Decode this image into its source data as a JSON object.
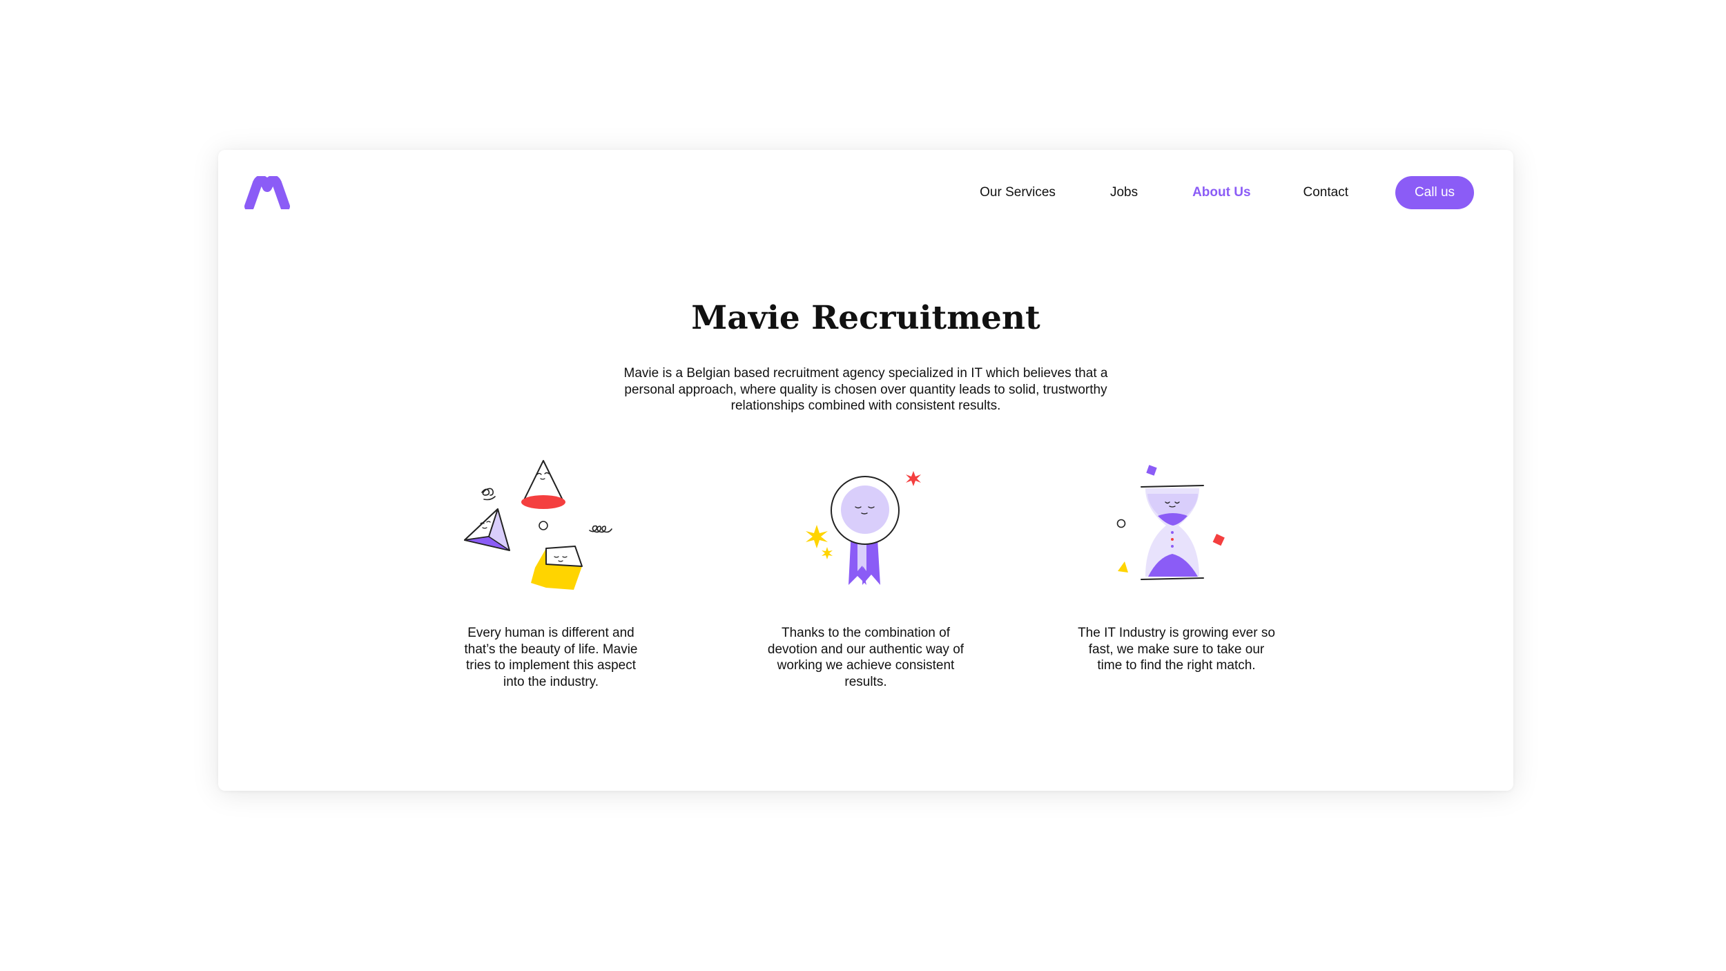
{
  "brand": {
    "logo_icon": "mavie-m-logo",
    "accent_color": "#8B5CF6"
  },
  "nav": {
    "items": [
      {
        "label": "Our Services"
      },
      {
        "label": "Jobs"
      },
      {
        "label": "About Us",
        "active": true
      },
      {
        "label": "Contact"
      }
    ],
    "cta_label": "Call us"
  },
  "hero": {
    "title": "Mavie Recruitment",
    "intro": "Mavie is a Belgian based recruitment agency specialized in IT which believes that a personal approach, where quality is chosen over quantity leads to solid, trustworthy relationships combined with consistent results."
  },
  "features": [
    {
      "icon": "geometric-shapes-icon",
      "text": "Every human is different and that’s the beauty of life. Mavie tries to implement this aspect into the industry."
    },
    {
      "icon": "award-ribbon-icon",
      "text": "Thanks to the combination of devotion and our authentic way of working we achieve consistent results."
    },
    {
      "icon": "hourglass-icon",
      "text": "The IT Industry is growing ever so fast, we make sure to take our time to find the right match."
    }
  ],
  "colors": {
    "purple": "#8B5CF6",
    "light_purple": "#D9CEFB",
    "red": "#F43F3F",
    "yellow": "#FFD400"
  }
}
